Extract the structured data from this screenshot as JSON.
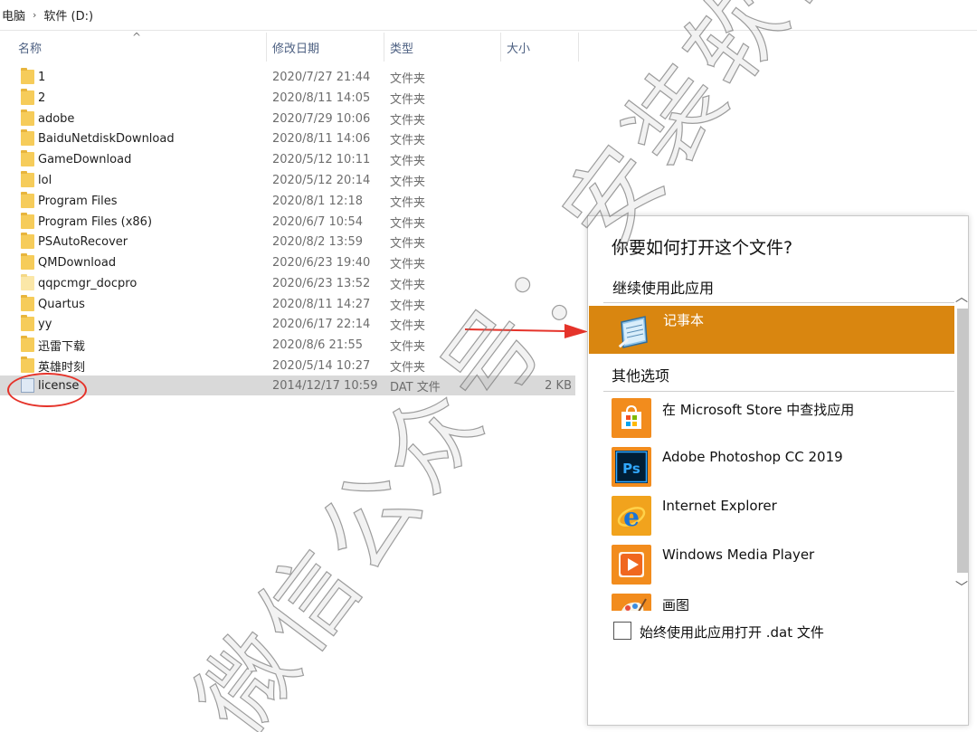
{
  "address": {
    "parts": [
      "电脑",
      "软件 (D:)"
    ]
  },
  "columns": {
    "name": "名称",
    "date": "修改日期",
    "type": "类型",
    "size": "大小"
  },
  "files": [
    {
      "name": "1",
      "date": "2020/7/27 21:44",
      "type": "文件夹",
      "size": "",
      "icon": "folder-icon"
    },
    {
      "name": "2",
      "date": "2020/8/11 14:05",
      "type": "文件夹",
      "size": "",
      "icon": "folder-icon"
    },
    {
      "name": "adobe",
      "date": "2020/7/29 10:06",
      "type": "文件夹",
      "size": "",
      "icon": "folder-icon"
    },
    {
      "name": "BaiduNetdiskDownload",
      "date": "2020/8/11 14:06",
      "type": "文件夹",
      "size": "",
      "icon": "folder-icon"
    },
    {
      "name": "GameDownload",
      "date": "2020/5/12 10:11",
      "type": "文件夹",
      "size": "",
      "icon": "folder-icon"
    },
    {
      "name": "lol",
      "date": "2020/5/12 20:14",
      "type": "文件夹",
      "size": "",
      "icon": "folder-icon"
    },
    {
      "name": "Program Files",
      "date": "2020/8/1 12:18",
      "type": "文件夹",
      "size": "",
      "icon": "folder-icon"
    },
    {
      "name": "Program Files (x86)",
      "date": "2020/6/7 10:54",
      "type": "文件夹",
      "size": "",
      "icon": "folder-icon"
    },
    {
      "name": "PSAutoRecover",
      "date": "2020/8/2 13:59",
      "type": "文件夹",
      "size": "",
      "icon": "folder-icon"
    },
    {
      "name": "QMDownload",
      "date": "2020/6/23 19:40",
      "type": "文件夹",
      "size": "",
      "icon": "folder-icon"
    },
    {
      "name": "qqpcmgr_docpro",
      "date": "2020/6/23 13:52",
      "type": "文件夹",
      "size": "",
      "icon": "folder-icon"
    },
    {
      "name": "Quartus",
      "date": "2020/8/11 14:27",
      "type": "文件夹",
      "size": "",
      "icon": "folder-icon"
    },
    {
      "name": "yy",
      "date": "2020/6/17 22:14",
      "type": "文件夹",
      "size": "",
      "icon": "folder-icon"
    },
    {
      "name": "迅雷下载",
      "date": "2020/8/6 21:55",
      "type": "文件夹",
      "size": "",
      "icon": "folder-icon"
    },
    {
      "name": "英雄时刻",
      "date": "2020/5/14 10:27",
      "type": "文件夹",
      "size": "",
      "icon": "folder-icon"
    },
    {
      "name": "license",
      "date": "2014/12/17 10:59",
      "type": "DAT 文件",
      "size": "2 KB",
      "icon": "document-icon"
    }
  ],
  "dialog": {
    "title": "你要如何打开这个文件?",
    "continue_label": "继续使用此应用",
    "current_app": {
      "label": "记事本",
      "icon": "notepad-icon"
    },
    "other_label": "其他选项",
    "apps": [
      {
        "label": "在 Microsoft Store 中查找应用",
        "icon": "microsoft-store-icon",
        "color": "#f28c1d"
      },
      {
        "label": "Adobe Photoshop CC 2019",
        "icon": "photoshop-icon",
        "color": "#001e36"
      },
      {
        "label": "Internet Explorer",
        "icon": "internet-explorer-icon",
        "color": "#f1a31d"
      },
      {
        "label": "Windows Media Player",
        "icon": "windows-media-player-icon",
        "color": "#f28c1d"
      },
      {
        "label": "画图",
        "icon": "paint-icon",
        "color": "#f28c1d"
      }
    ],
    "always_use_label": "始终使用此应用打开 .dat 文件"
  },
  "watermark": "微信公众号：安装软件指南",
  "colors": {
    "accent": "#d98610",
    "selected_row": "#d9d9d9",
    "annotation_red": "#e5332a"
  }
}
